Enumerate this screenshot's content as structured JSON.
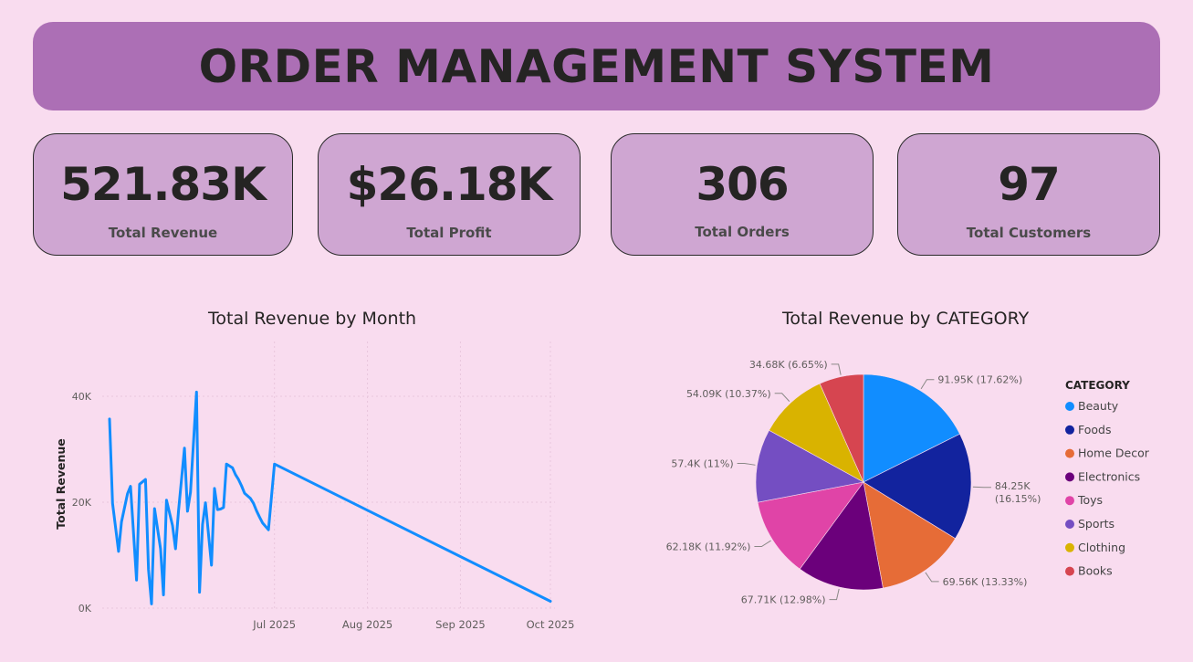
{
  "header": {
    "title": "ORDER MANAGEMENT SYSTEM"
  },
  "kpis": [
    {
      "value": "521.83K",
      "label": "Total Revenue"
    },
    {
      "value": "$26.18K",
      "label": "Total Profit"
    },
    {
      "value": "306",
      "label": "Total Orders"
    },
    {
      "value": "97",
      "label": "Total Customers"
    }
  ],
  "chart_data": [
    {
      "type": "line",
      "title": "Total Revenue by Month",
      "xlabel": "",
      "ylabel": "Total Revenue",
      "ylim": [
        0,
        45000
      ],
      "grid": true,
      "line_color": "#118dff",
      "x_ticks": [
        "Jul 2025",
        "Aug 2025",
        "Sep 2025",
        "Oct 2025"
      ],
      "y_ticks": [
        {
          "value": 0,
          "label": "0K"
        },
        {
          "value": 20000,
          "label": "20K"
        },
        {
          "value": 40000,
          "label": "40K"
        }
      ],
      "series": [
        {
          "x": [
            "2025-05-07",
            "2025-05-08",
            "2025-05-10",
            "2025-05-11",
            "2025-05-13",
            "2025-05-14",
            "2025-05-16",
            "2025-05-17",
            "2025-05-19",
            "2025-05-20",
            "2025-05-21",
            "2025-05-22",
            "2025-05-24",
            "2025-05-25",
            "2025-05-26",
            "2025-05-28",
            "2025-05-29",
            "2025-05-30",
            "2025-06-01",
            "2025-06-02",
            "2025-06-03",
            "2025-06-05",
            "2025-06-06",
            "2025-06-07",
            "2025-06-08",
            "2025-06-10",
            "2025-06-11",
            "2025-06-12",
            "2025-06-13",
            "2025-06-14",
            "2025-06-15",
            "2025-06-17",
            "2025-06-18",
            "2025-06-19",
            "2025-06-20",
            "2025-06-21",
            "2025-06-23",
            "2025-06-24",
            "2025-06-25",
            "2025-06-26",
            "2025-06-27",
            "2025-06-29",
            "2025-07-01",
            "2025-10-01"
          ],
          "y": [
            35700,
            19800,
            10700,
            16300,
            21600,
            23000,
            5300,
            23400,
            24300,
            7300,
            800,
            18800,
            11200,
            2500,
            20400,
            15600,
            11200,
            18400,
            30200,
            18300,
            21900,
            40800,
            3000,
            15800,
            19900,
            8100,
            22600,
            18600,
            18700,
            19000,
            27200,
            26500,
            25200,
            24300,
            23100,
            21700,
            20700,
            19800,
            18400,
            17200,
            16100,
            14800,
            27200,
            1300
          ]
        }
      ]
    },
    {
      "type": "pie",
      "title": "Total Revenue by CATEGORY",
      "legend_title": "CATEGORY",
      "legend_position": "right",
      "slices": [
        {
          "name": "Beauty",
          "value": 91950,
          "pct": 17.62,
          "label": "91.95K (17.62%)",
          "color": "#118dff"
        },
        {
          "name": "Foods",
          "value": 84250,
          "pct": 16.15,
          "label": "84.25K (16.15%)",
          "color": "#12239e"
        },
        {
          "name": "Home Decor",
          "value": 69560,
          "pct": 13.33,
          "label": "69.56K (13.33%)",
          "color": "#e66c37"
        },
        {
          "name": "Electronics",
          "value": 67710,
          "pct": 12.98,
          "label": "67.71K (12.98%)",
          "color": "#6b007b"
        },
        {
          "name": "Toys",
          "value": 62180,
          "pct": 11.92,
          "label": "62.18K (11.92%)",
          "color": "#e044a7"
        },
        {
          "name": "Sports",
          "value": 57400,
          "pct": 11.0,
          "label": "57.4K (11%)",
          "color": "#744ec2"
        },
        {
          "name": "Clothing",
          "value": 54090,
          "pct": 10.37,
          "label": "54.09K (10.37%)",
          "color": "#d9b300"
        },
        {
          "name": "Books",
          "value": 34680,
          "pct": 6.65,
          "label": "34.68K (6.65%)",
          "color": "#d64550"
        }
      ]
    }
  ]
}
